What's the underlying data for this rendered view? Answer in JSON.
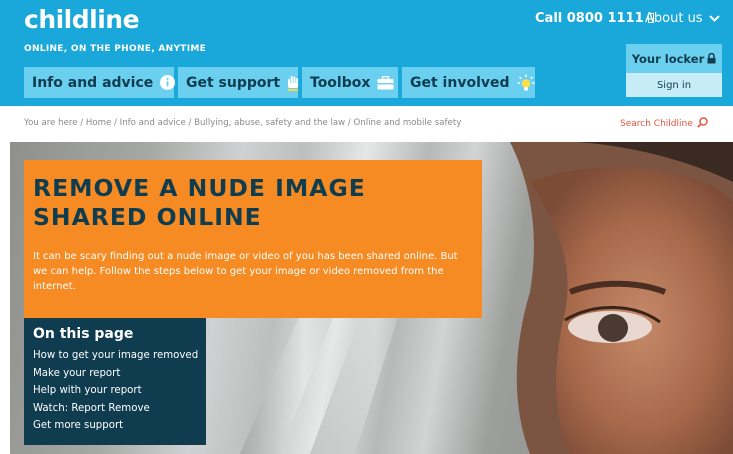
{
  "header": {
    "logo": "childline",
    "tagline": "Online, on the phone, anytime",
    "call_label": "Call 0800 1111",
    "about_label": "About us",
    "nav": [
      {
        "label": "Info and advice",
        "icon": "info-icon"
      },
      {
        "label": "Get support",
        "icon": "hand-icon"
      },
      {
        "label": "Toolbox",
        "icon": "toolbox-icon"
      },
      {
        "label": "Get involved",
        "icon": "lightbulb-icon"
      }
    ],
    "locker_label": "Your locker",
    "signin_label": "Sign in"
  },
  "breadcrumb": {
    "prefix": "You are here /",
    "items": [
      "Home",
      "Info and advice",
      "Bullying, abuse, safety and the law",
      "Online and mobile safety"
    ],
    "separator": "/"
  },
  "search": {
    "label": "Search Childline"
  },
  "hero": {
    "title": "Remove a nude image shared online",
    "intro": "It can be scary finding out a nude image or video of you has been shared online. But we can help. Follow the steps below to get your image or video removed from the internet."
  },
  "on_this_page": {
    "title": "On this page",
    "items": [
      "How to get your image removed",
      "Make your report",
      "Help with your report",
      "Watch: Report Remove",
      "Get more support"
    ]
  },
  "colors": {
    "header_bg": "#1aa7d9",
    "nav_bg": "#6bd0ef",
    "navy": "#0f3c4f",
    "orange": "#f68b23",
    "search_red": "#e8543f"
  }
}
